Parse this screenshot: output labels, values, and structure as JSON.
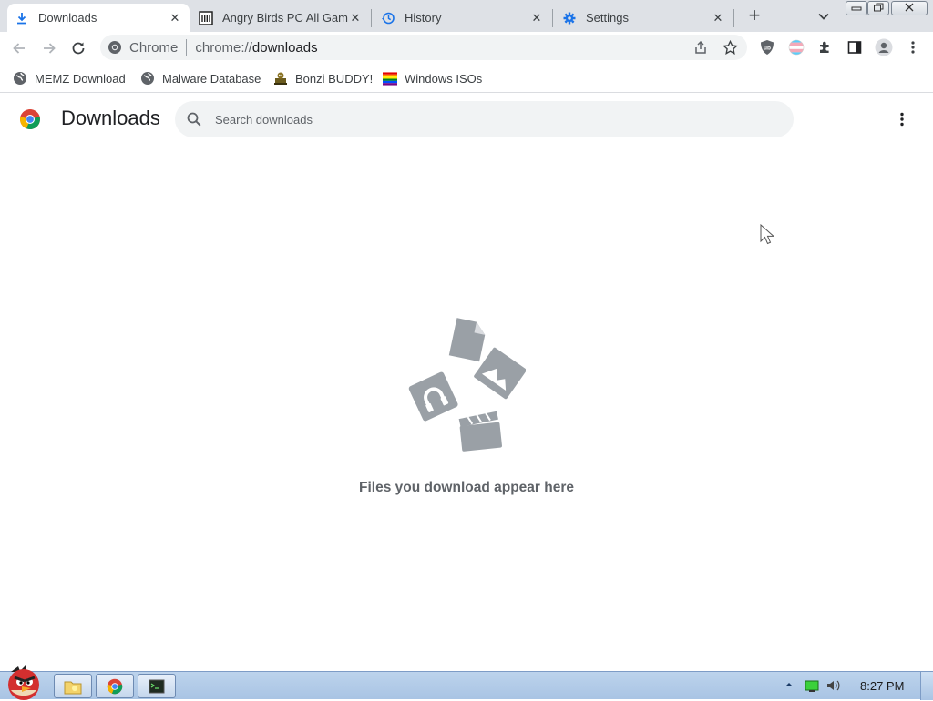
{
  "tabs": [
    {
      "title": "Downloads",
      "icon": "download-icon",
      "active": true
    },
    {
      "title": "Angry Birds PC All Gam",
      "icon": "archive-icon",
      "active": false
    },
    {
      "title": "History",
      "icon": "history-icon",
      "active": false
    },
    {
      "title": "Settings",
      "icon": "settings-gear-icon",
      "active": false
    }
  ],
  "omnibox": {
    "site_label": "Chrome",
    "url_prefix": "chrome://",
    "url_path": "downloads"
  },
  "bookmarks": [
    {
      "label": "MEMZ Download",
      "icon": "globe-icon"
    },
    {
      "label": "Malware Database",
      "icon": "globe-icon"
    },
    {
      "label": "Bonzi BUDDY!",
      "icon": "bonzi-icon"
    },
    {
      "label": "Windows ISOs",
      "icon": "rainbow-flag-icon"
    }
  ],
  "page": {
    "title": "Downloads",
    "search_placeholder": "Search downloads",
    "empty_message": "Files you download appear here"
  },
  "taskbar": {
    "clock": "8:27 PM"
  },
  "colors": {
    "accent": "#1a73e8",
    "tab_strip": "#dee1e6",
    "omnibox_bg": "#f1f3f4",
    "illustration": "#9aa0a6",
    "empty_text": "#5f6368",
    "taskbar": "#b4cce8"
  }
}
